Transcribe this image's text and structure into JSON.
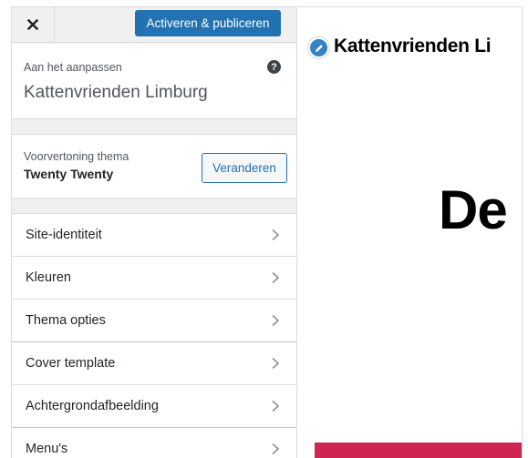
{
  "topbar": {
    "close_icon": "close-icon",
    "publish_label": "Activeren & publiceren",
    "accent_color": "#2271b1"
  },
  "info": {
    "customizing_label": "Aan het aanpassen",
    "site_title": "Kattenvrienden Limburg",
    "help_icon": "help-icon"
  },
  "theme": {
    "preview_label": "Voorvertoning thema",
    "name": "Twenty Twenty",
    "change_label": "Veranderen"
  },
  "menu": {
    "items": [
      {
        "label": "Site-identiteit"
      },
      {
        "label": "Kleuren"
      },
      {
        "label": "Thema opties"
      },
      {
        "label": "Cover template"
      },
      {
        "label": "Achtergrondafbeelding"
      },
      {
        "label": "Menu's"
      }
    ],
    "chevron_icon": "chevron-right-icon"
  },
  "preview": {
    "site_title": "Kattenvrienden Li",
    "heading": "De",
    "edit_icon": "pencil-icon",
    "accent_color": "#cd2653"
  }
}
